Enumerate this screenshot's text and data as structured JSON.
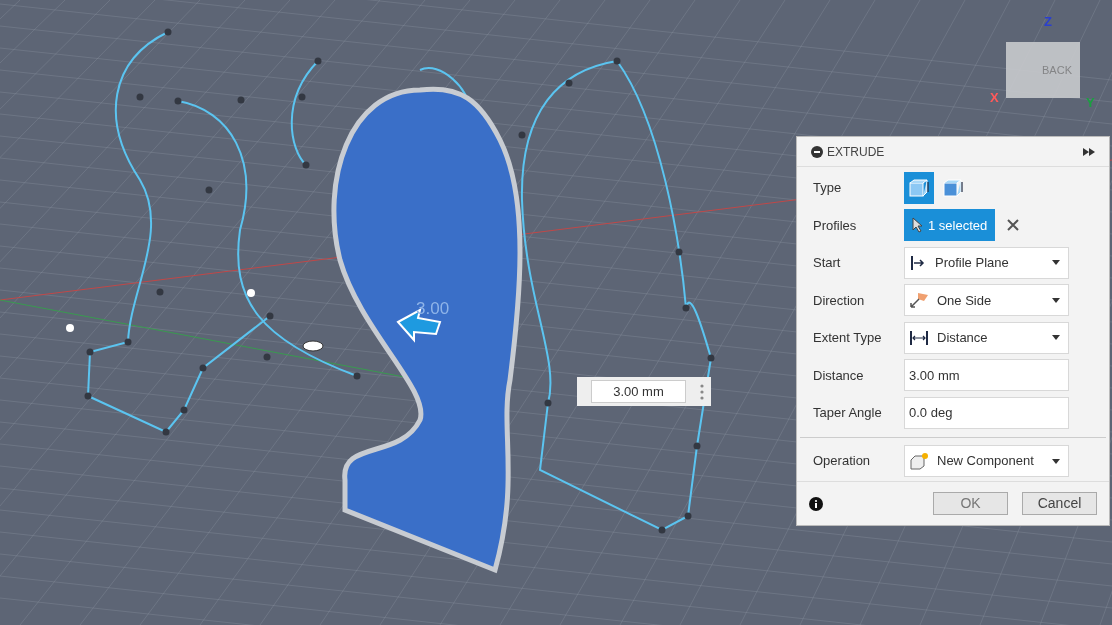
{
  "viewport": {
    "dimension_label": "3.00",
    "dimension_input": {
      "value": "3.00 mm"
    },
    "view_cube": {
      "face_label": "BACK",
      "axes": [
        {
          "label": "Z",
          "color": "#2a3fd0"
        },
        {
          "label": "X",
          "color": "#ff5a5a"
        },
        {
          "label": "Y",
          "color": "#1aa040"
        }
      ]
    }
  },
  "dialog": {
    "title": "EXTRUDE",
    "rows": [
      {
        "kind": "type",
        "label": "Type",
        "options": [
          {
            "selected": true
          },
          {
            "selected": false
          }
        ]
      },
      {
        "kind": "selection",
        "label": "Profiles",
        "value": "1 selected"
      },
      {
        "kind": "dropdown",
        "label": "Start",
        "value": "Profile Plane"
      },
      {
        "kind": "dropdown",
        "label": "Direction",
        "value": "One Side"
      },
      {
        "kind": "dropdown",
        "label": "Extent Type",
        "value": "Distance"
      },
      {
        "kind": "input",
        "label": "Distance",
        "value": "3.00 mm"
      },
      {
        "kind": "input",
        "label": "Taper Angle",
        "value": "0.0 deg"
      }
    ],
    "operation": {
      "label": "Operation",
      "value": "New Component"
    },
    "buttons": [
      {
        "label": "OK"
      },
      {
        "label": "Cancel"
      }
    ]
  }
}
